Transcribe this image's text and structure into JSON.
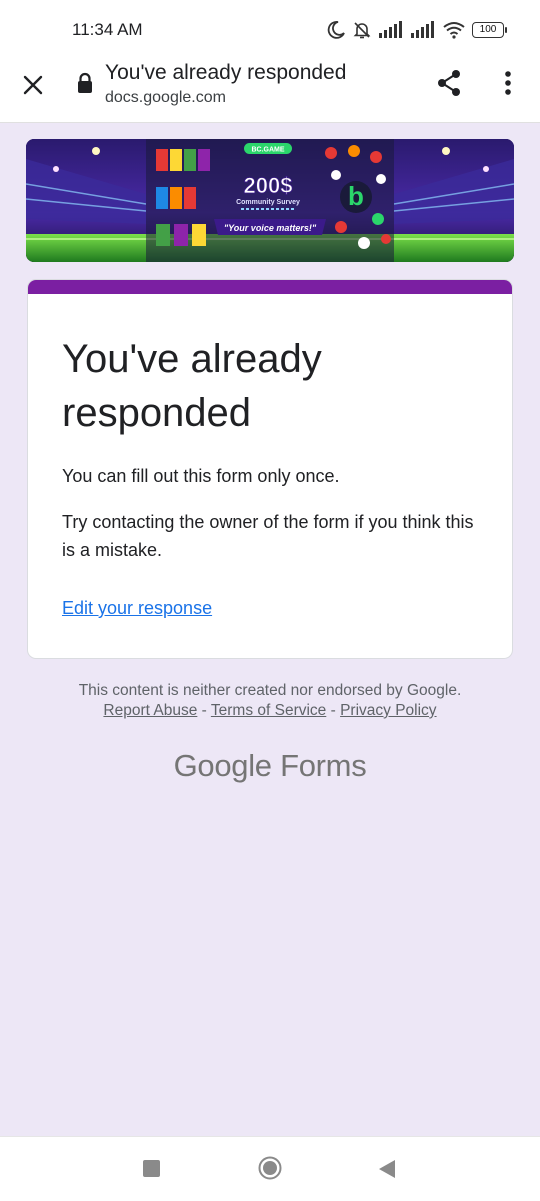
{
  "status_bar": {
    "time": "11:34 AM",
    "battery": "100"
  },
  "browser": {
    "title": "You've already responded",
    "url": "docs.google.com"
  },
  "banner": {
    "brand": "BC.GAME",
    "amount": "200$",
    "subtitle": "Community Survey",
    "tagline": "\"Your voice matters!\""
  },
  "card": {
    "heading": "You've already responded",
    "line1": "You can fill out this form only once.",
    "line2": "Try contacting the owner of the form if you think this is a mistake.",
    "edit_link": "Edit your response",
    "accent_color": "#7b1fa2"
  },
  "footer": {
    "disclaimer": "This content is neither created nor endorsed by Google.",
    "report_abuse": "Report Abuse",
    "separator": "-",
    "terms": "Terms of Service",
    "privacy": "Privacy Policy",
    "logo_google": "Google",
    "logo_forms": "Forms"
  }
}
